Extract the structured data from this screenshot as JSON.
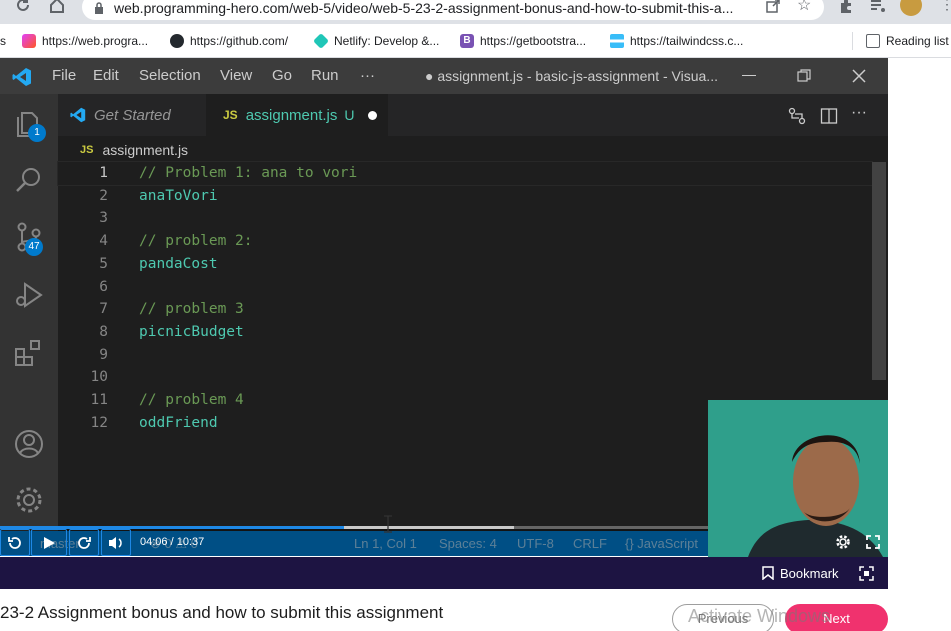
{
  "browser": {
    "url": "web.programming-hero.com/web-5/video/web-5-23-2-assignment-bonus-and-how-to-submit-this-a...",
    "bookmarks": [
      {
        "label": "s",
        "icon": ""
      },
      {
        "label": "https://web.progra...",
        "icon": "programming-hero-icon"
      },
      {
        "label": "https://github.com/",
        "icon": "github-icon"
      },
      {
        "label": "Netlify: Develop &...",
        "icon": "netlify-icon"
      },
      {
        "label": "https://getbootstra...",
        "icon": "bootstrap-icon"
      },
      {
        "label": "https://tailwindcss.c...",
        "icon": "tailwind-icon"
      }
    ],
    "reading_list": "Reading list"
  },
  "vscode": {
    "menu": [
      "File",
      "Edit",
      "Selection",
      "View",
      "Go",
      "Run",
      "···"
    ],
    "window_title": "● assignment.js - basic-js-assignment - Visua...",
    "tabs": [
      {
        "label": "Get Started",
        "icon": "vscode-logo-icon",
        "active": false
      },
      {
        "label": "assignment.js",
        "badge": "JS",
        "suffix": "U",
        "active": true
      }
    ],
    "breadcrumb": {
      "badge": "JS",
      "file": "assignment.js"
    },
    "activity_badges": {
      "explorer": "1",
      "source_control": "47"
    },
    "lines": [
      {
        "n": "1",
        "text": "// Problem 1: ana to vori",
        "kind": "comment"
      },
      {
        "n": "2",
        "text": "anaToVori",
        "kind": "ident"
      },
      {
        "n": "3",
        "text": "",
        "kind": "blank"
      },
      {
        "n": "4",
        "text": "// problem 2:",
        "kind": "comment"
      },
      {
        "n": "5",
        "text": "pandaCost",
        "kind": "ident"
      },
      {
        "n": "6",
        "text": "",
        "kind": "blank"
      },
      {
        "n": "7",
        "text": "// problem 3",
        "kind": "comment"
      },
      {
        "n": "8",
        "text": "picnicBudget",
        "kind": "ident"
      },
      {
        "n": "9",
        "text": "",
        "kind": "blank"
      },
      {
        "n": "10",
        "text": "",
        "kind": "blank"
      },
      {
        "n": "11",
        "text": "// problem 4",
        "kind": "comment"
      },
      {
        "n": "12",
        "text": "oddFriend",
        "kind": "ident"
      }
    ],
    "status": {
      "branch": "master",
      "errors": "0",
      "warnings": "0",
      "position": "Ln 1, Col 1",
      "spaces": "Spaces: 4",
      "encoding": "UTF-8",
      "eol": "CRLF",
      "language": "{} JavaScript"
    }
  },
  "player": {
    "time": "04:06 / 10:37",
    "progress": 0.387,
    "bookmark_label": "Bookmark"
  },
  "page": {
    "video_title": "23-2 Assignment bonus and how to submit this assignment",
    "previous_label": "Previous",
    "next_label": "Next",
    "watermark": "Activate Windows"
  },
  "colors": {
    "accent": "#007acc",
    "player_bar": "#1d1442",
    "next_button": "#f0326e",
    "comment": "#6a9955",
    "identifier": "#4ec9b0"
  }
}
